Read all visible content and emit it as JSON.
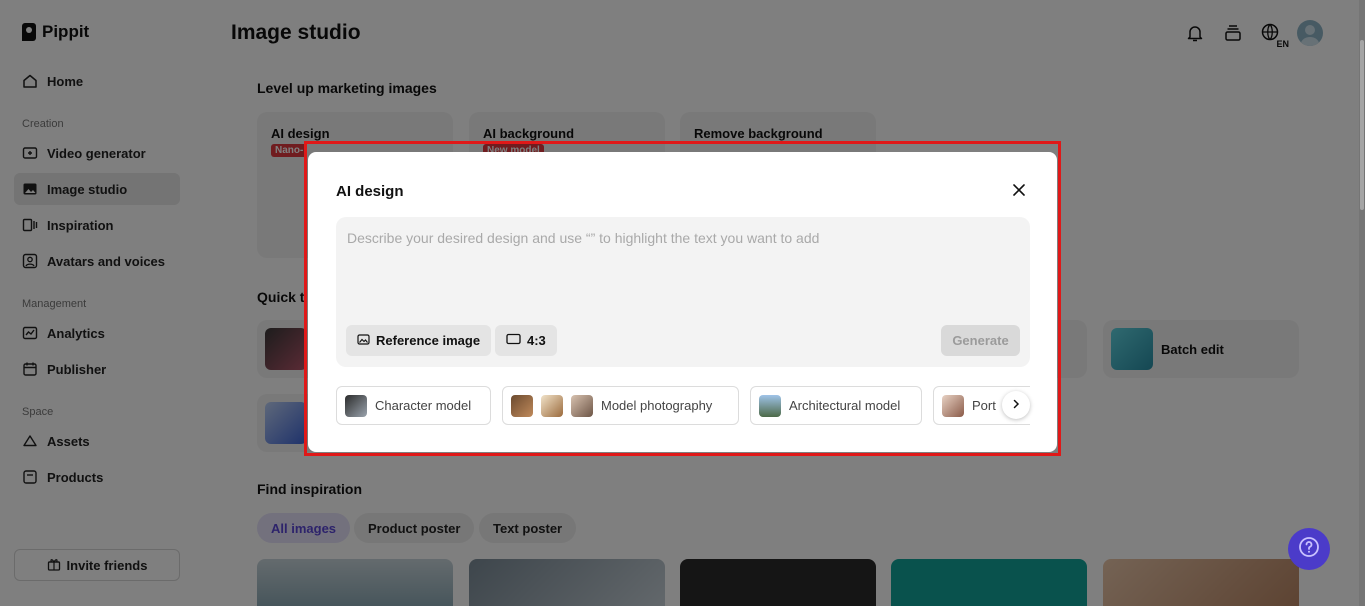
{
  "app": {
    "logo_text": "Pippit"
  },
  "sidebar": {
    "home": "Home",
    "section_creation": "Creation",
    "video_generator": "Video generator",
    "image_studio": "Image studio",
    "inspiration": "Inspiration",
    "avatars_voices": "Avatars and voices",
    "section_management": "Management",
    "analytics": "Analytics",
    "publisher": "Publisher",
    "section_space": "Space",
    "assets": "Assets",
    "products": "Products",
    "invite_friends": "Invite friends"
  },
  "header": {
    "title": "Image studio",
    "language": "EN"
  },
  "main": {
    "section_marketing": "Level up marketing images",
    "cards": [
      {
        "title": "AI design",
        "badge": "Nano-"
      },
      {
        "title": "AI background",
        "badge": "New model"
      },
      {
        "title": "Remove background"
      }
    ],
    "section_quick": "Quick t",
    "batch_edit": "Batch edit",
    "section_inspiration": "Find inspiration",
    "filters": [
      "All images",
      "Product poster",
      "Text poster"
    ]
  },
  "modal": {
    "title": "AI design",
    "prompt_placeholder": "Describe your desired design and use “” to highlight the text you want to add",
    "reference_image": "Reference image",
    "aspect_ratio": "4:3",
    "generate": "Generate",
    "presets": [
      "Character model",
      "Model photography",
      "Architectural model",
      "Port"
    ]
  },
  "colors": {
    "accent": "#4b3bc9",
    "highlight": "#e01818",
    "badge": "#e0393e"
  }
}
